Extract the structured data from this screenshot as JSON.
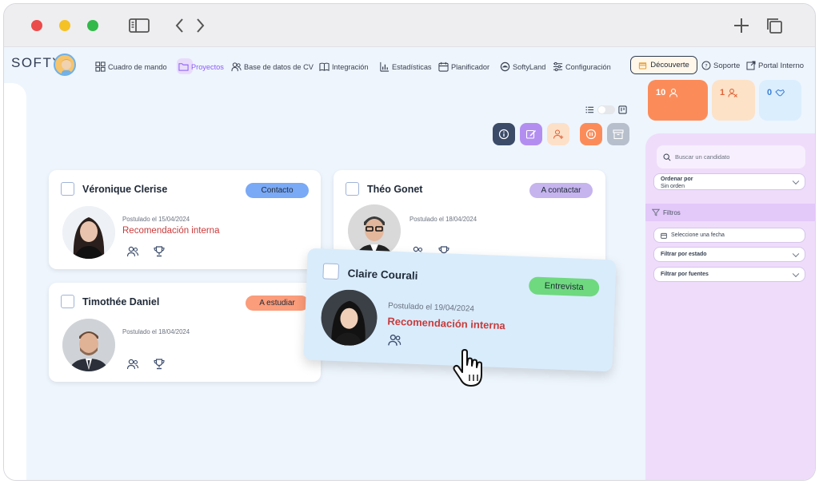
{
  "window": {
    "controls": [
      "close",
      "minimize",
      "maximize"
    ],
    "toolbar_icons": [
      "sidebar-icon",
      "back-icon",
      "forward-icon",
      "new-tab-icon",
      "tabs-overview-icon"
    ]
  },
  "brand": {
    "logo_text": "SOFTY"
  },
  "nav": {
    "items": [
      {
        "label": "Cuadro de mando",
        "icon": "dashboard-icon"
      },
      {
        "label": "Proyectos",
        "icon": "folder-icon",
        "active": true
      },
      {
        "label": "Base de datos de CV",
        "icon": "users-icon"
      },
      {
        "label": "Integración",
        "icon": "book-icon"
      },
      {
        "label": "Estadísticas",
        "icon": "chart-icon"
      },
      {
        "label": "Planificador",
        "icon": "calendar-icon"
      },
      {
        "label": "SoftyLand",
        "icon": "softyland-icon"
      },
      {
        "label": "Configuración",
        "icon": "settings-icon"
      }
    ],
    "decouverte": "Découverte",
    "soporte": "Soporte",
    "portal": "Portal Interno"
  },
  "stats": [
    {
      "value": "10",
      "icon": "user-icon",
      "color": "#fb8c5a"
    },
    {
      "value": "1",
      "icon": "user-x-icon",
      "color": "#fde2c7"
    },
    {
      "value": "0",
      "icon": "handshake-icon",
      "color": "#dbeefe"
    }
  ],
  "colors": {
    "accent_purple": "#8b5cf6",
    "badge_contacto": "#7aa9f5",
    "badge_a_contactar": "#c5b4ee",
    "badge_a_estudiar": "#fb9c7a",
    "badge_entrevista": "#6fd97f",
    "source_red": "#c83b3b"
  },
  "toolbar": {
    "buttons": [
      "info-icon",
      "edit-icon",
      "add-user-icon",
      "pause-icon",
      "archive-icon"
    ]
  },
  "candidates": [
    {
      "name": "Véronique Clerise",
      "status": "Contacto",
      "posted": "Postulado el 15/04/2024",
      "source": "Recomendación interna"
    },
    {
      "name": "Théo Gonet",
      "status": "A contactar",
      "posted": "Postulado el 18/04/2024",
      "source": ""
    },
    {
      "name": "Timothée Daniel",
      "status": "A estudiar",
      "posted": "Postulado el 18/04/2024",
      "source": ""
    },
    {
      "name": "Claire Courali",
      "status": "Entrevista",
      "posted": "Postulado el 19/04/2024",
      "source": "Recomendación interna"
    }
  ],
  "sidebar": {
    "search_placeholder": "Buscar un candidato",
    "sort_label": "Ordenar por",
    "sort_value": "Sin orden",
    "filters_title": "Filtros",
    "date_placeholder": "Seleccione una fecha",
    "filter_state": "Filtrar por estado",
    "filter_sources": "Filtrar por fuentes"
  }
}
